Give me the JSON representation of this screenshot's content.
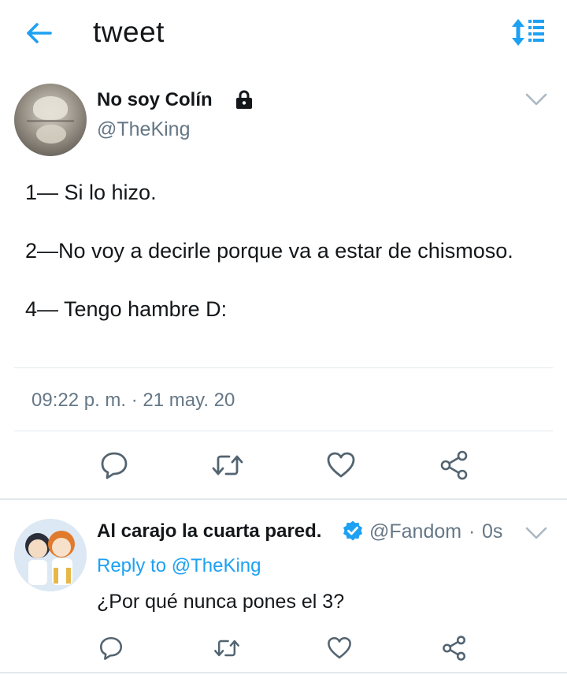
{
  "header": {
    "title": "tweet",
    "back_icon": "arrow-left-icon",
    "sort_icon": "sort-list-icon",
    "accent": "#1da1f2"
  },
  "tweet": {
    "author_name": "No soy Colín",
    "handle": "@TheKing",
    "protected_icon": "lock-icon",
    "text": "1— Si lo hizo.\n\n2—No voy a decirle porque va a estar de chismoso.\n\n4— Tengo hambre D:",
    "time": "09:22 p. m.",
    "separator": "·",
    "date": "21 may. 20",
    "actions": [
      "reply-icon",
      "retweet-icon",
      "like-icon",
      "share-icon"
    ]
  },
  "reply": {
    "author_name": "Al carajo la cuarta pared.",
    "verified_icon": "verified-badge-icon",
    "handle": "@Fandom",
    "separator": "·",
    "time": "0s",
    "reply_to_label": "Reply to",
    "reply_to_handle": "@TheKing",
    "text": "¿Por qué nunca pones el 3?",
    "actions": [
      "reply-icon",
      "retweet-icon",
      "like-icon",
      "share-icon"
    ]
  },
  "colors": {
    "text": "#14171a",
    "secondary": "#657786",
    "divider": "#e1e8ed",
    "icon": "#536471"
  }
}
